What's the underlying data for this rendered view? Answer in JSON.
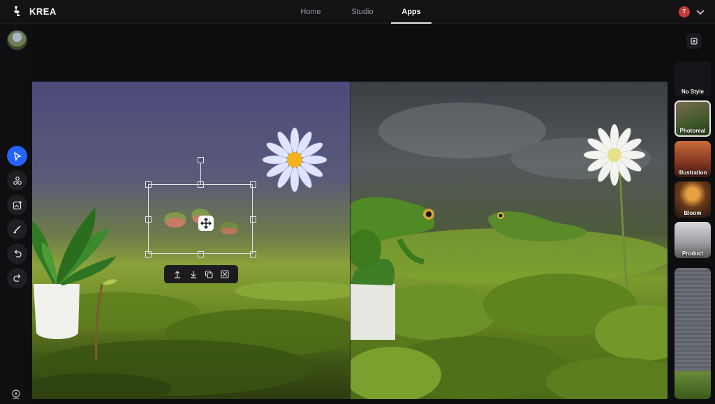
{
  "app": {
    "name": "KREA"
  },
  "nav": {
    "tabs": [
      {
        "label": "Home"
      },
      {
        "label": "Studio"
      },
      {
        "label": "Apps"
      }
    ],
    "active": "Apps"
  },
  "user": {
    "initial": "T"
  },
  "styles": [
    {
      "label": "No Style"
    },
    {
      "label": "Photoreal"
    },
    {
      "label": "Illustration"
    },
    {
      "label": "Bloom"
    },
    {
      "label": "Product"
    }
  ],
  "selected_style": "Photoreal",
  "colors": {
    "accent": "#2563ff",
    "avatar": "#c93a3a"
  }
}
